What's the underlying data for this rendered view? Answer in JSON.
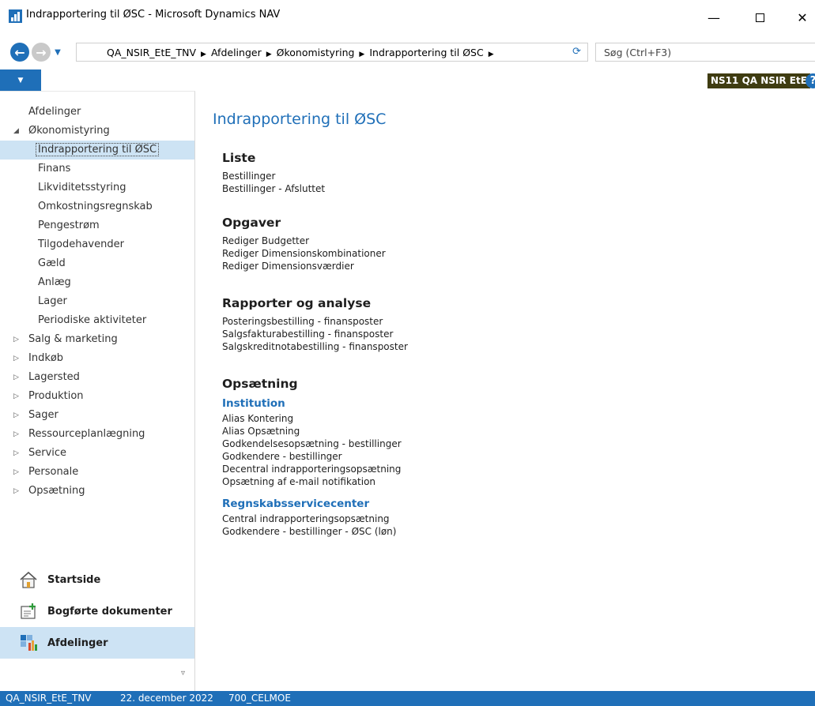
{
  "window": {
    "title": "Indrapportering til ØSC - Microsoft Dynamics NAV",
    "minimize_glyph": "—",
    "close_glyph": "✕"
  },
  "nav": {
    "back_glyph": "←",
    "forward_glyph": "→",
    "breadcrumbs": [
      "QA_NSIR_EtE_TNV",
      "Afdelinger",
      "Økonomistyring",
      "Indrapportering til ØSC"
    ],
    "breadcrumb_sep": "▶",
    "refresh_glyph": "⟳",
    "search_placeholder": "Søg (Ctrl+F3)"
  },
  "ribbon": {
    "toggle_glyph": "▼",
    "company": "NS11 QA NSIR EtE",
    "help_glyph": "?"
  },
  "tree": {
    "expanded_glyph": "◢",
    "collapsed_glyph": "▷",
    "top": "Afdelinger",
    "expanded": "Økonomistyring",
    "children": [
      "Indrapportering til ØSC",
      "Finans",
      "Likviditetsstyring",
      "Omkostningsregnskab",
      "Pengestrøm",
      "Tilgodehavender",
      "Gæld",
      "Anlæg",
      "Lager",
      "Periodiske aktiviteter"
    ],
    "collapsed": [
      "Salg & marketing",
      "Indkøb",
      "Lagersted",
      "Produktion",
      "Sager",
      "Ressourceplanlægning",
      "Service",
      "Personale",
      "Opsætning"
    ]
  },
  "groups": {
    "home": "Startside",
    "posted": "Bogførte dokumenter",
    "departments": "Afdelinger",
    "footer_glyph": "▿"
  },
  "content": {
    "title": "Indrapportering til ØSC",
    "liste": {
      "heading": "Liste",
      "items": [
        "Bestillinger",
        "Bestillinger - Afsluttet"
      ]
    },
    "opgaver": {
      "heading": "Opgaver",
      "items": [
        "Rediger Budgetter",
        "Rediger Dimensionskombinationer",
        "Rediger Dimensionsværdier"
      ]
    },
    "rapporter": {
      "heading": "Rapporter og analyse",
      "items": [
        "Posteringsbestilling - finansposter",
        "Salgsfakturabestilling - finansposter",
        "Salgskreditnotabestilling - finansposter"
      ]
    },
    "opsaetning": {
      "heading": "Opsætning",
      "institution": {
        "heading": "Institution",
        "items": [
          "Alias Kontering",
          "Alias Opsætning",
          "Godkendelsesopsætning - bestillinger",
          "Godkendere - bestillinger",
          "Decentral indrapporteringsopsætning",
          "Opsætning af e-mail notifikation"
        ]
      },
      "rsc": {
        "heading": "Regnskabsservicecenter",
        "items": [
          "Central indrapporteringsopsætning",
          "Godkendere - bestillinger - ØSC (løn)"
        ]
      }
    }
  },
  "status": {
    "company": "QA_NSIR_EtE_TNV",
    "date": "22. december 2022",
    "user": "700_CELMOE"
  },
  "colors": {
    "accent": "#1f6fb8",
    "selected_bg": "#cde3f4",
    "badge_bg": "#3f3c11"
  }
}
